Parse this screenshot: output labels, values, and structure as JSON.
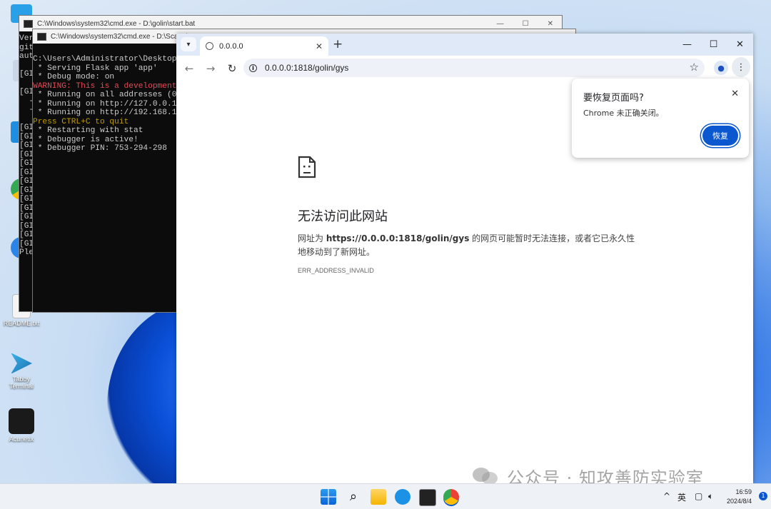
{
  "desktop": {
    "icons": [
      {
        "label": "README.txt"
      },
      {
        "label": "Tabby\nTerminal"
      },
      {
        "label": "Acunetix"
      }
    ]
  },
  "cmd_back": {
    "title": "C:\\Windows\\system32\\cmd.exe - D:\\golin\\start.bat",
    "lines": [
      "Ver",
      "git",
      "aut",
      "",
      "[GI",
      "",
      "[GI",
      "  -",
      "  -",
      "",
      "[GI",
      "[GI",
      "[GI",
      "[GI",
      "[GI",
      "[GI",
      "[GI",
      "[GI",
      "[GI",
      "[GI",
      "[GI",
      "[GI",
      "[GI",
      "[GI",
      "Ple"
    ]
  },
  "cmd_front": {
    "title": "C:\\Windows\\system32\\cmd.exe - D:\\Scannin",
    "lines": [
      {
        "text": "C:\\Users\\Administrator\\Desktop>D",
        "color": "normal"
      },
      {
        "text": " * Serving Flask app 'app'",
        "color": "normal"
      },
      {
        "text": " * Debug mode: on",
        "color": "normal"
      },
      {
        "text": "WARNING: This is a development s",
        "color": "red"
      },
      {
        "text": " * Running on all addresses (0.0",
        "color": "normal"
      },
      {
        "text": " * Running on http://127.0.0.1:50",
        "color": "normal"
      },
      {
        "text": " * Running on http://192.168.11.",
        "color": "normal"
      },
      {
        "text": "Press CTRL+C to quit",
        "color": "yellow"
      },
      {
        "text": " * Restarting with stat",
        "color": "normal"
      },
      {
        "text": " * Debugger is active!",
        "color": "normal"
      },
      {
        "text": " * Debugger PIN: 753-294-298",
        "color": "normal"
      }
    ]
  },
  "browser": {
    "tab_title": "0.0.0.0",
    "url": "0.0.0.0:1818/golin/gys",
    "error": {
      "title": "无法访问此网站",
      "desc_prefix": "网址为 ",
      "desc_url": "https://0.0.0.0:1818/golin/gys",
      "desc_suffix": " 的网页可能暂时无法连接，或者它已永久性地移动到了新网址。",
      "code": "ERR_ADDRESS_INVALID"
    },
    "restore_popup": {
      "title": "要恢复页面吗?",
      "body": "Chrome 未正确关闭。",
      "button": "恢复"
    }
  },
  "taskbar": {
    "tray_ime": "英",
    "tray_caret": "^",
    "time": "16:59",
    "date": "2024/8/4",
    "notifications": "1"
  },
  "watermark": "公众号 · 知攻善防实验室"
}
